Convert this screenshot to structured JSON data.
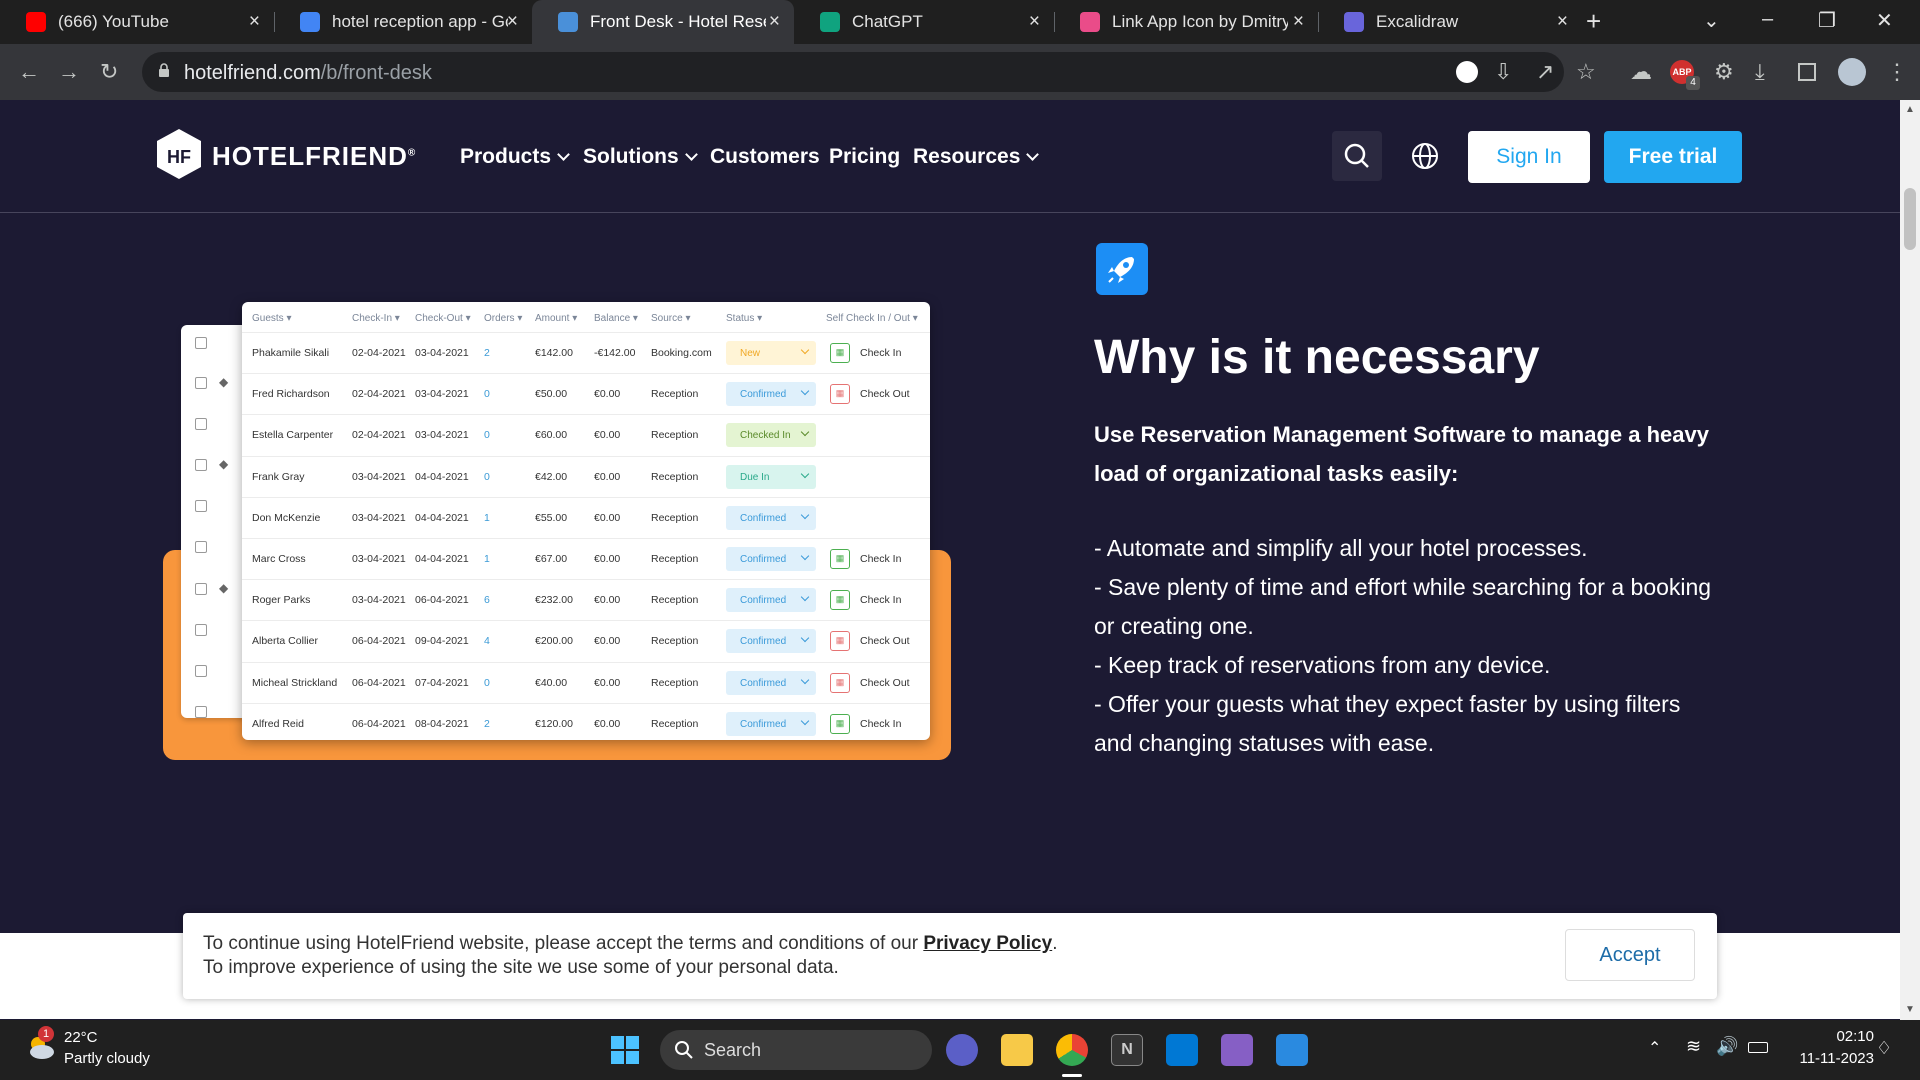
{
  "browser": {
    "tabs": [
      {
        "title": "(666) YouTube",
        "icon": "youtube-icon",
        "color": "#ff0000"
      },
      {
        "title": "hotel reception app - Go",
        "icon": "google-icon",
        "color": "#4285f4"
      },
      {
        "title": "Front Desk - Hotel Reser",
        "icon": "hotelfriend-icon",
        "color": "#4a90d9"
      },
      {
        "title": "ChatGPT",
        "icon": "chatgpt-icon",
        "color": "#10a37f"
      },
      {
        "title": "Link App Icon by Dmitry",
        "icon": "dribbble-icon",
        "color": "#ea4c89"
      },
      {
        "title": "Excalidraw",
        "icon": "excalidraw-icon",
        "color": "#6965db"
      }
    ],
    "url_host": "hotelfriend.com",
    "url_path": "/b/front-desk",
    "new_tab": "+",
    "ext_badge": "4"
  },
  "site": {
    "logo_mark": "HF",
    "logo_text": "HOTELFRIEND",
    "logo_reg": "®",
    "nav": [
      "Products",
      "Solutions",
      "Customers",
      "Pricing",
      "Resources"
    ],
    "sign_in": "Sign In",
    "free_trial": "Free trial",
    "accent": "#22a7f0"
  },
  "table": {
    "headers": [
      "Guests",
      "Check-In",
      "Check-Out",
      "Orders",
      "Amount",
      "Balance",
      "Source",
      "Status",
      "Self Check In / Out"
    ],
    "rows": [
      {
        "guest": "Phakamile Sikali",
        "in": "02-04-2021",
        "out": "03-04-2021",
        "orders": "2",
        "amount": "€142.00",
        "balance": "-€142.00",
        "source": "Booking.com",
        "status": "New",
        "self": "Check In"
      },
      {
        "guest": "Fred Richardson",
        "in": "02-04-2021",
        "out": "03-04-2021",
        "orders": "0",
        "amount": "€50.00",
        "balance": "€0.00",
        "source": "Reception",
        "status": "Confirmed",
        "self": "Check Out"
      },
      {
        "guest": "Estella Carpenter",
        "in": "02-04-2021",
        "out": "03-04-2021",
        "orders": "0",
        "amount": "€60.00",
        "balance": "€0.00",
        "source": "Reception",
        "status": "Checked In",
        "self": ""
      },
      {
        "guest": "Frank Gray",
        "in": "03-04-2021",
        "out": "04-04-2021",
        "orders": "0",
        "amount": "€42.00",
        "balance": "€0.00",
        "source": "Reception",
        "status": "Due In",
        "self": ""
      },
      {
        "guest": "Don McKenzie",
        "in": "03-04-2021",
        "out": "04-04-2021",
        "orders": "1",
        "amount": "€55.00",
        "balance": "€0.00",
        "source": "Reception",
        "status": "Confirmed",
        "self": ""
      },
      {
        "guest": "Marc Cross",
        "in": "03-04-2021",
        "out": "04-04-2021",
        "orders": "1",
        "amount": "€67.00",
        "balance": "€0.00",
        "source": "Reception",
        "status": "Confirmed",
        "self": "Check In"
      },
      {
        "guest": "Roger Parks",
        "in": "03-04-2021",
        "out": "06-04-2021",
        "orders": "6",
        "amount": "€232.00",
        "balance": "€0.00",
        "source": "Reception",
        "status": "Confirmed",
        "self": "Check In"
      },
      {
        "guest": "Alberta Collier",
        "in": "06-04-2021",
        "out": "09-04-2021",
        "orders": "4",
        "amount": "€200.00",
        "balance": "€0.00",
        "source": "Reception",
        "status": "Confirmed",
        "self": "Check Out"
      },
      {
        "guest": "Micheal Strickland",
        "in": "06-04-2021",
        "out": "07-04-2021",
        "orders": "0",
        "amount": "€40.00",
        "balance": "€0.00",
        "source": "Reception",
        "status": "Confirmed",
        "self": "Check Out"
      },
      {
        "guest": "Alfred Reid",
        "in": "06-04-2021",
        "out": "08-04-2021",
        "orders": "2",
        "amount": "€120.00",
        "balance": "€0.00",
        "source": "Reception",
        "status": "Confirmed",
        "self": "Check In"
      }
    ]
  },
  "content": {
    "heading": "Why is it necessary",
    "lead": "Use Reservation Management Software to manage a heavy load of organizational tasks easily:",
    "bullets": [
      "- Automate and simplify all your hotel processes.",
      "- Save plenty of time and effort while searching for a booking",
      "or creating one.",
      "- Keep track of reservations from any device.",
      "- Offer your guests what they expect faster by using filters",
      "and changing statuses with ease."
    ]
  },
  "cookie": {
    "line1_a": "To continue using HotelFriend website, please accept the terms and conditions of our ",
    "link": "Privacy Policy",
    "line1_b": ".",
    "line2": "To improve experience of using the site we use some of your personal data.",
    "accept": "Accept"
  },
  "taskbar": {
    "temp": "22°C",
    "weather": "Partly cloudy",
    "weather_badge": "1",
    "search": "Search",
    "time": "02:10",
    "date": "11-11-2023"
  }
}
